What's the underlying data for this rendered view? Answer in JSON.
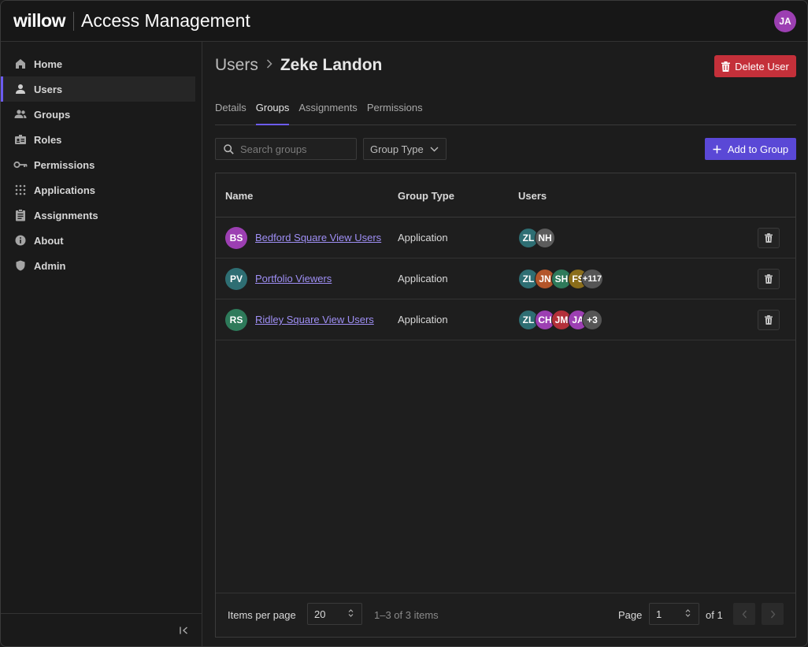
{
  "header": {
    "logo": "willow",
    "title": "Access Management",
    "user_initials": "JA"
  },
  "sidebar": {
    "items": [
      {
        "label": "Home",
        "icon": "home-icon"
      },
      {
        "label": "Users",
        "icon": "user-icon",
        "active": true
      },
      {
        "label": "Groups",
        "icon": "group-icon"
      },
      {
        "label": "Roles",
        "icon": "role-badge-icon"
      },
      {
        "label": "Permissions",
        "icon": "key-icon"
      },
      {
        "label": "Applications",
        "icon": "apps-grid-icon"
      },
      {
        "label": "Assignments",
        "icon": "clipboard-icon"
      },
      {
        "label": "About",
        "icon": "info-icon"
      },
      {
        "label": "Admin",
        "icon": "shield-icon"
      }
    ]
  },
  "main": {
    "breadcrumb": {
      "parent": "Users",
      "current": "Zeke Landon"
    },
    "delete_user_label": "Delete User",
    "tabs": [
      {
        "label": "Details"
      },
      {
        "label": "Groups",
        "active": true
      },
      {
        "label": "Assignments"
      },
      {
        "label": "Permissions"
      }
    ],
    "search": {
      "placeholder": "Search groups"
    },
    "filter_label": "Group Type",
    "add_group_label": "Add to Group"
  },
  "table": {
    "headers": {
      "name": "Name",
      "group_type": "Group Type",
      "users": "Users"
    },
    "rows": [
      {
        "initials": "BS",
        "color": "#9c3fb2",
        "name": "Bedford Square View Users",
        "type": "Application",
        "users": [
          {
            "t": "ZL",
            "c": "#2e6e73"
          },
          {
            "t": "NH",
            "c": "#5c5c5c"
          }
        ]
      },
      {
        "initials": "PV",
        "color": "#2e6e73",
        "name": "Portfolio Viewers",
        "type": "Application",
        "users": [
          {
            "t": "ZL",
            "c": "#2e6e73"
          },
          {
            "t": "JN",
            "c": "#b3552a"
          },
          {
            "t": "SH",
            "c": "#2e7a5a"
          },
          {
            "t": "FS",
            "c": "#8a6d1a"
          },
          {
            "t": "+117",
            "c": "#555555"
          }
        ]
      },
      {
        "initials": "RS",
        "color": "#2e7a5a",
        "name": "Ridley Square View Users",
        "type": "Application",
        "users": [
          {
            "t": "ZL",
            "c": "#2e6e73"
          },
          {
            "t": "CH",
            "c": "#9c3fb2"
          },
          {
            "t": "JM",
            "c": "#b3303a"
          },
          {
            "t": "JA",
            "c": "#9c3fb2"
          },
          {
            "t": "+3",
            "c": "#555555"
          }
        ]
      }
    ]
  },
  "footer": {
    "items_per_page_label": "Items per page",
    "items_per_page_value": "20",
    "range_text": "1–3 of 3 items",
    "page_label": "Page",
    "page_value": "1",
    "page_of": "of 1"
  }
}
